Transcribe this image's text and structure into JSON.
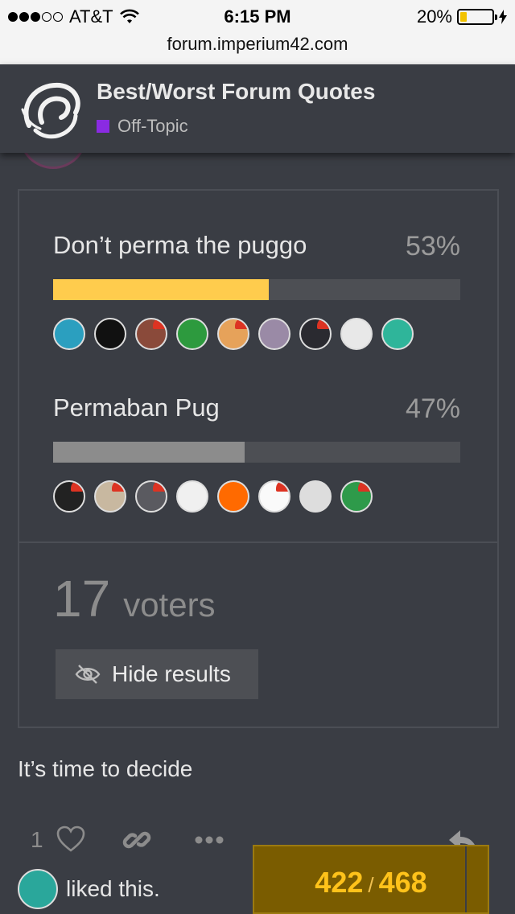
{
  "status_bar": {
    "carrier": "AT&T",
    "time": "6:15 PM",
    "battery": "20%",
    "battery_level": 0.2,
    "url": "forum.imperium42.com"
  },
  "topic": {
    "title": "Best/Worst Forum Quotes",
    "category": "Off-Topic",
    "category_color": "#8a2be2"
  },
  "poll": {
    "options": [
      {
        "label": "Don’t perma the puggo",
        "percent": "53%",
        "fraction": 0.53,
        "color": "#ffcc4d"
      },
      {
        "label": "Permaban Pug",
        "percent": "47%",
        "fraction": 0.47,
        "color": "#8c8c8c"
      }
    ],
    "voters_count": "17",
    "voters_label": "voters",
    "hide_results_label": "Hide results"
  },
  "post": {
    "text": "It’s time to decide",
    "like_count": "1",
    "liked_text": "liked this."
  },
  "progress": {
    "current": "422",
    "separator": "/",
    "total": "468"
  }
}
